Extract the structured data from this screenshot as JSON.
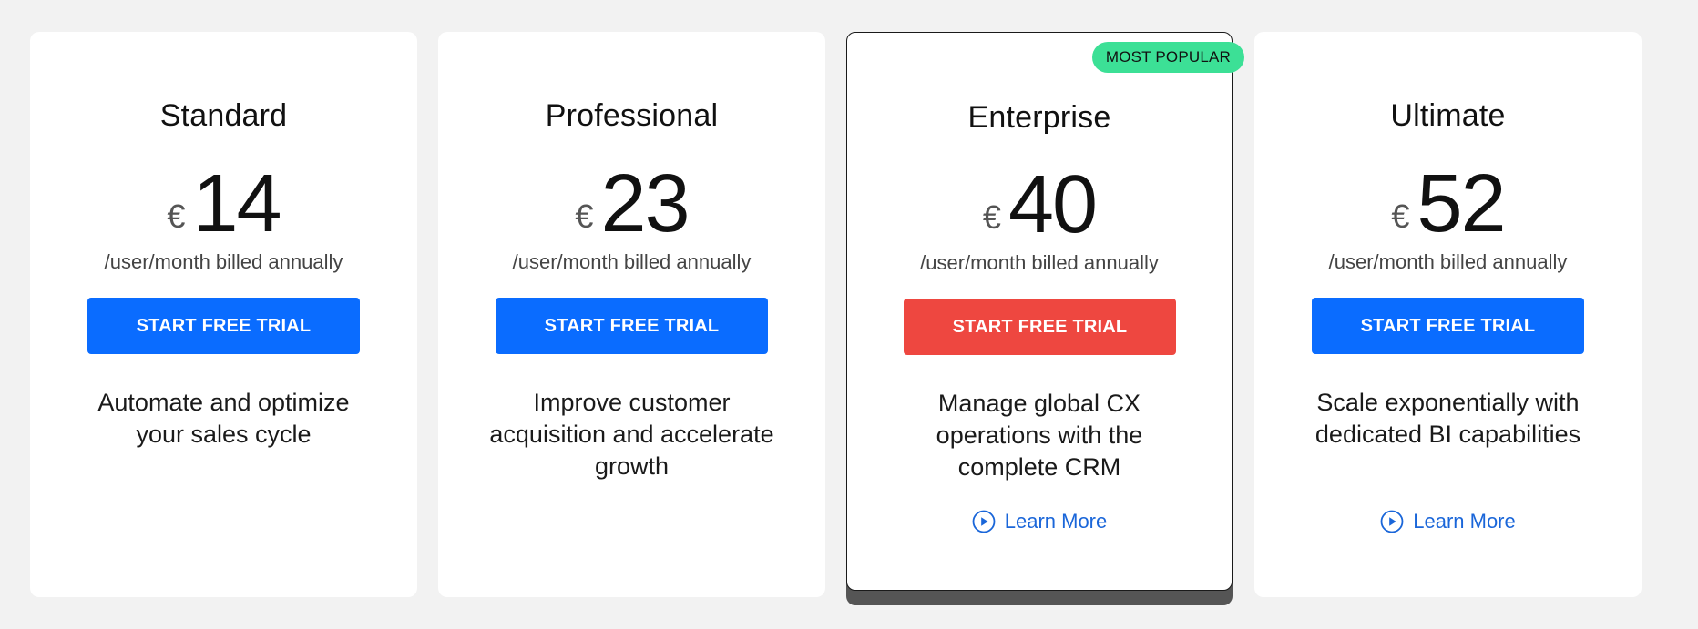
{
  "colors": {
    "primary_button": "#0a6cff",
    "featured_button": "#ee4740",
    "badge": "#3ce096",
    "link": "#1a66d9"
  },
  "plans": [
    {
      "name": "Standard",
      "currency": "€",
      "price": "14",
      "billing": "/user/month billed annually",
      "cta": "START FREE TRIAL",
      "description": "Automate and optimize your sales cycle"
    },
    {
      "name": "Professional",
      "currency": "€",
      "price": "23",
      "billing": "/user/month billed annually",
      "cta": "START FREE TRIAL",
      "description": "Improve customer acquisition and accelerate growth"
    },
    {
      "name": "Enterprise",
      "currency": "€",
      "price": "40",
      "billing": "/user/month billed annually",
      "cta": "START FREE TRIAL",
      "description": "Manage global CX operations with the complete CRM",
      "badge": "MOST POPULAR",
      "learn_more": "Learn More",
      "learn_more_icon": "play-circle-icon"
    },
    {
      "name": "Ultimate",
      "currency": "€",
      "price": "52",
      "billing": "/user/month billed annually",
      "cta": "START FREE TRIAL",
      "description": "Scale exponentially with dedicated BI capabilities",
      "learn_more": "Learn More",
      "learn_more_icon": "play-circle-icon"
    }
  ]
}
